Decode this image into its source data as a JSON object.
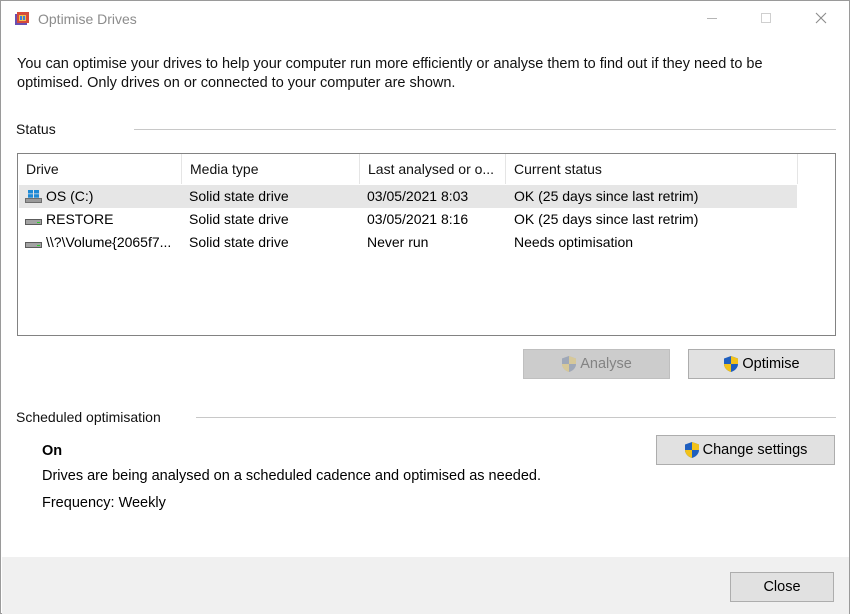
{
  "window": {
    "title": "Optimise Drives",
    "app_icon": "defrag-app-icon",
    "controls": [
      "minimize",
      "maximize",
      "close"
    ]
  },
  "intro_text_line1": "You can optimise your drives to help your computer run more efficiently or analyse them to find out if they need to be",
  "intro_text_line2": "optimised. Only drives on or connected to your computer are shown.",
  "status": {
    "label": "Status",
    "columns": [
      "Drive",
      "Media type",
      "Last analysed or o...",
      "Current status"
    ],
    "rows": [
      {
        "drive": "OS (C:)",
        "icon": "windows-drive-icon",
        "media": "Solid state drive",
        "last": "03/05/2021 8:03",
        "status": "OK (25 days since last retrim)"
      },
      {
        "drive": "RESTORE",
        "icon": "drive-icon",
        "media": "Solid state drive",
        "last": "03/05/2021 8:16",
        "status": "OK (25 days since last retrim)"
      },
      {
        "drive": "\\\\?\\Volume{2065f7...",
        "icon": "drive-icon",
        "media": "Solid state drive",
        "last": "Never run",
        "status": "Needs optimisation"
      }
    ]
  },
  "buttons": {
    "analyse": "Analyse",
    "optimise": "Optimise",
    "change_settings": "Change settings",
    "close": "Close"
  },
  "scheduled": {
    "label": "Scheduled optimisation",
    "state": "On",
    "description": "Drives are being analysed on a scheduled cadence and optimised as needed.",
    "frequency": "Frequency: Weekly"
  }
}
